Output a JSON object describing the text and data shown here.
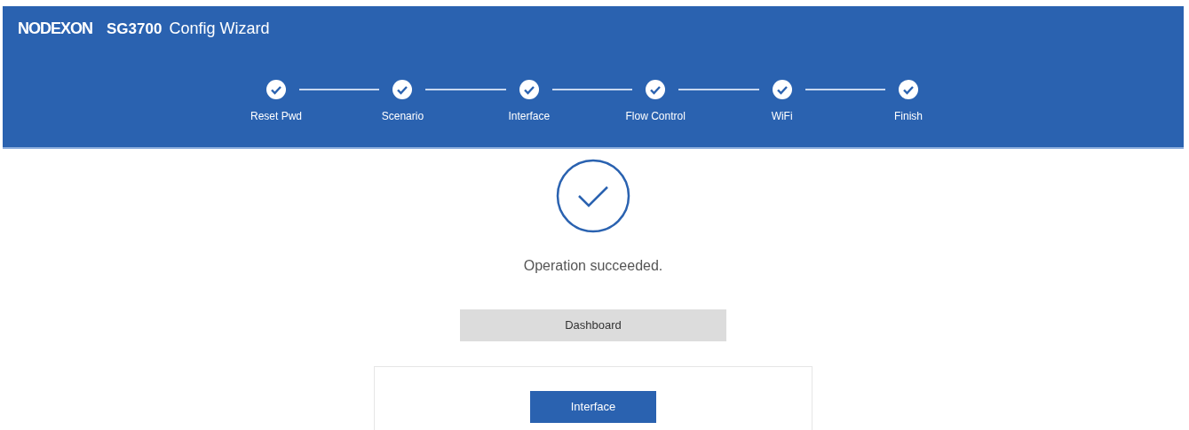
{
  "header": {
    "logo": "NODEXON",
    "model": "SG3700",
    "title": "Config Wizard"
  },
  "steps": [
    {
      "label": "Reset Pwd",
      "done": true
    },
    {
      "label": "Scenario",
      "done": true
    },
    {
      "label": "Interface",
      "done": true
    },
    {
      "label": "Flow Control",
      "done": true
    },
    {
      "label": "WiFi",
      "done": true
    },
    {
      "label": "Finish",
      "done": true
    }
  ],
  "result": {
    "message": "Operation succeeded.",
    "primary_button": "Dashboard"
  },
  "card": {
    "button": "Interface"
  }
}
